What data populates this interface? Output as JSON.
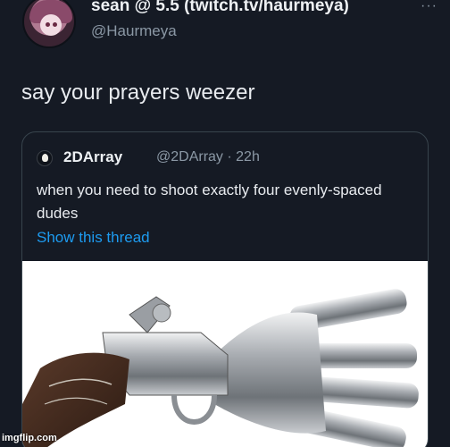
{
  "author": {
    "display_name": "sean @ 5.5 (twitch.tv/haurmeya)",
    "handle": "@Haurmeya",
    "avatar_icon": "anime-avatar"
  },
  "more_label": "···",
  "tweet_text": "say your prayers weezer",
  "quote": {
    "avatar_icon": "ice-cream-avatar",
    "name": "2DArray",
    "meta": "@2DArray · 22h",
    "text": "when you need to shoot exactly four evenly-spaced dudes",
    "thread_link": "Show this thread",
    "media_icon": "four-barrel-flintlock-pistol-image"
  },
  "watermark": "imgflip.com",
  "colors": {
    "background": "#151a24",
    "secondary_text": "#8b98a5",
    "link": "#1d9bf0",
    "border": "#38444d"
  }
}
